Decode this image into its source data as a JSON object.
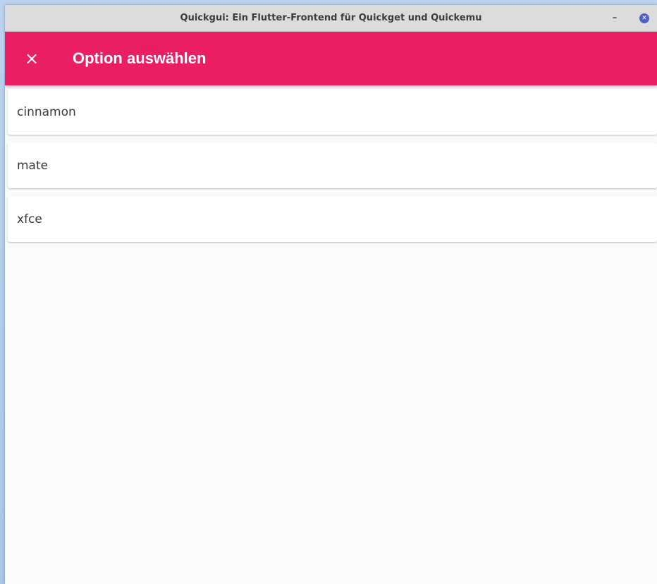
{
  "window": {
    "title": "Quickgui: Ein Flutter-Frontend für Quickget und Quickemu",
    "minimize_label": "–",
    "close_label": "✕"
  },
  "appbar": {
    "close_icon": "×",
    "title": "Option auswählen",
    "color": "#e91e63"
  },
  "options": [
    {
      "label": "cinnamon"
    },
    {
      "label": "mate"
    },
    {
      "label": "xfce"
    }
  ]
}
